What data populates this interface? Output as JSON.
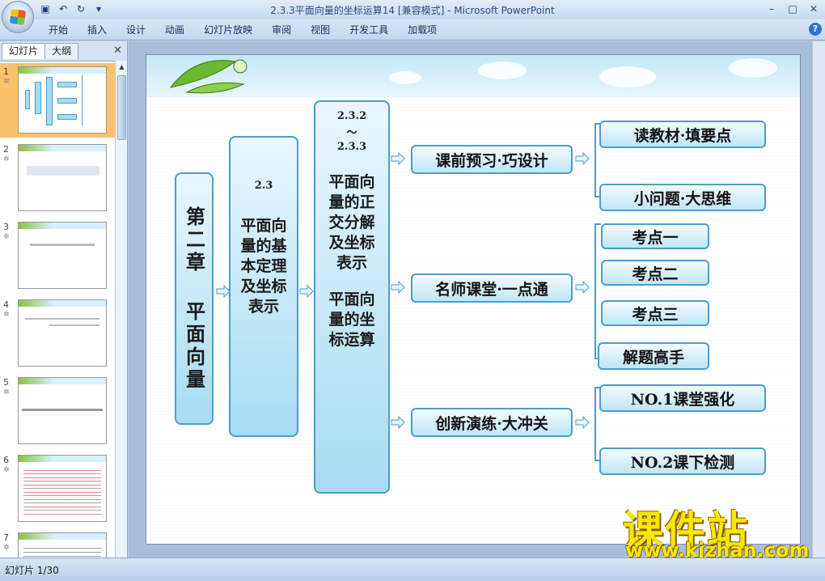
{
  "window": {
    "title": "2.3.3平面向量的坐标运算14 [兼容模式] - Microsoft PowerPoint"
  },
  "quick_access": {
    "save": "save-icon",
    "undo": "undo-icon",
    "redo": "redo-icon"
  },
  "ribbon": {
    "tabs": [
      "开始",
      "插入",
      "设计",
      "动画",
      "幻灯片放映",
      "审阅",
      "视图",
      "开发工具",
      "加载项"
    ],
    "help": "?"
  },
  "left_pane": {
    "tab_slides": "幻灯片",
    "tab_outline": "大纲",
    "close": "✕",
    "slide_numbers": [
      "1",
      "2",
      "3",
      "4",
      "5",
      "6",
      "7"
    ]
  },
  "slide": {
    "chapter": "第二章 平面向量",
    "section_num": "2.3",
    "section_title": "平面向量的基本定理及坐标表示",
    "subsection_num1": "2.3.2",
    "subsection_tilde": "～",
    "subsection_num2": "2.3.3",
    "subsection_title1": "平面向量的正交分解及坐标表示",
    "subsection_title2": "平面向量的坐标运算",
    "branches": [
      "课前预习·巧设计",
      "名师课堂·一点通",
      "创新演练·大冲关"
    ],
    "leaves": {
      "b1": [
        "读教材·填要点",
        "小问题·大思维"
      ],
      "b2": [
        "考点一",
        "考点二",
        "考点三",
        "解题高手"
      ],
      "b3": [
        "NO.1课堂强化",
        "NO.2课下检测"
      ]
    }
  },
  "watermark": {
    "cn": "课件站",
    "url": "www.kjzhan.com"
  },
  "status_bar": {
    "slide_count": "幻灯片 1/30"
  },
  "colors": {
    "box_border": "#4b9dcc",
    "box_fill_top": "#e8f7ff",
    "box_fill_bottom": "#a6dcf2",
    "selected_thumb": "#f9c36b",
    "watermark": "#f6e800"
  }
}
